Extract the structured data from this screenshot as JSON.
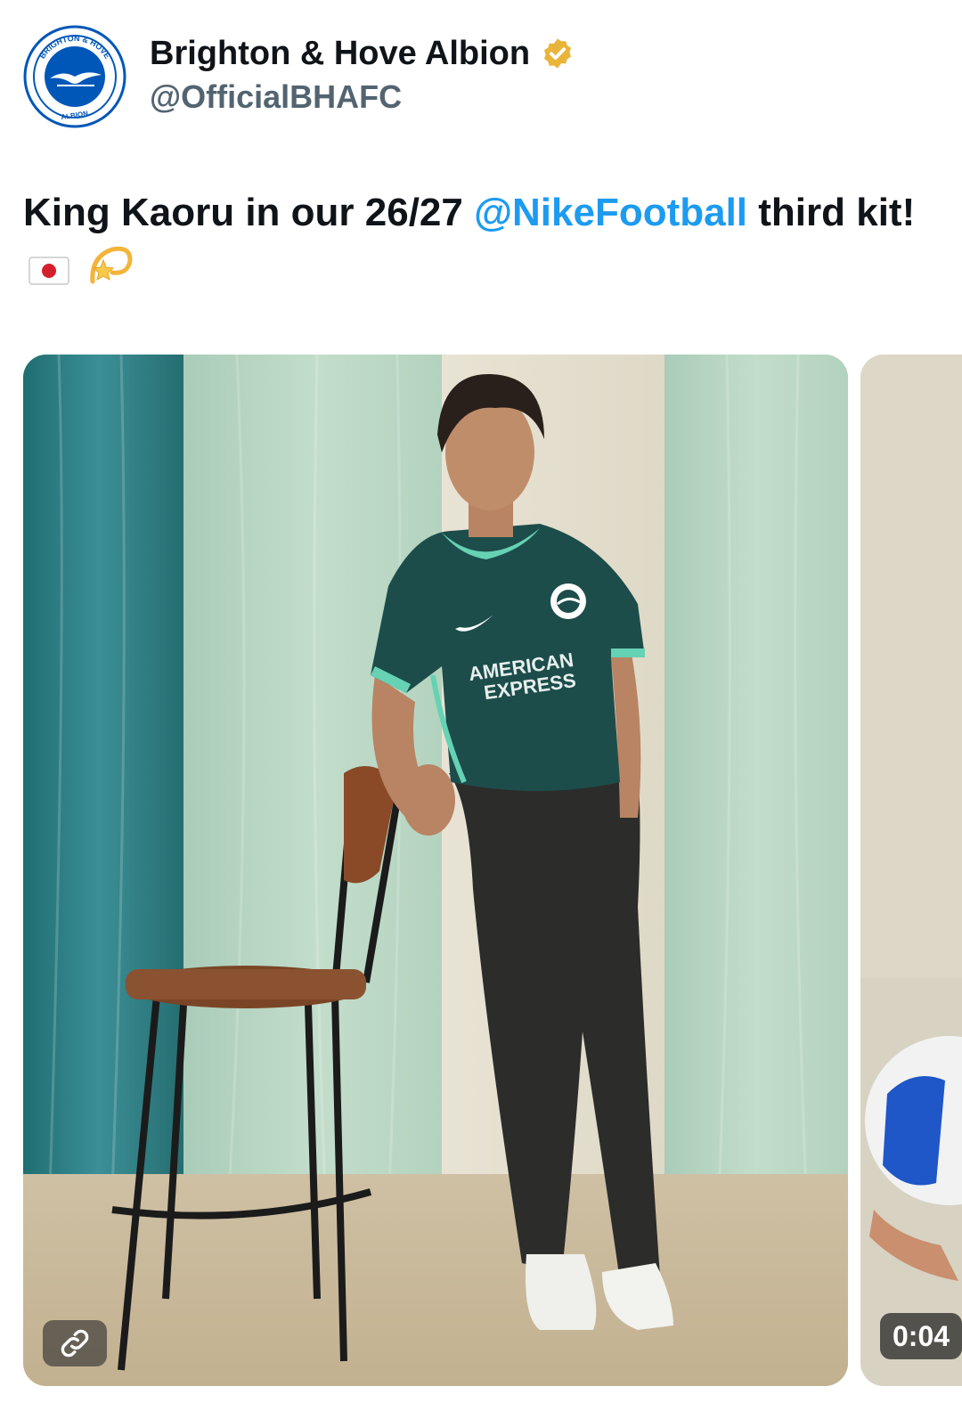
{
  "account": {
    "display_name": "Brighton & Hove Albion",
    "handle": "@OfficialBHAFC",
    "verified": true,
    "avatar_icon": "brighton-crest-icon",
    "avatar_ring_text_top": "BRIGHTON & HOVE",
    "avatar_ring_text_bottom": "ALBION"
  },
  "tweet": {
    "text_before": "King Kaoru in our 26/27 ",
    "mention": "@NikeFootball",
    "text_after": " third kit!",
    "emojis": [
      "japan-flag-icon",
      "dizzy-star-icon"
    ]
  },
  "media": {
    "main": {
      "shirt_sponsor_line1": "AMERICAN",
      "shirt_sponsor_line2": "EXPRESS",
      "badge_icon": "link-icon"
    },
    "next": {
      "duration": "0:04"
    }
  },
  "colors": {
    "mention": "#1d9bf0",
    "handle": "#536471",
    "verified_gold": "#e8b53a",
    "brighton_blue": "#0057b8",
    "shirt_teal": "#1c4d4b",
    "shirt_trim": "#66d2b4"
  }
}
